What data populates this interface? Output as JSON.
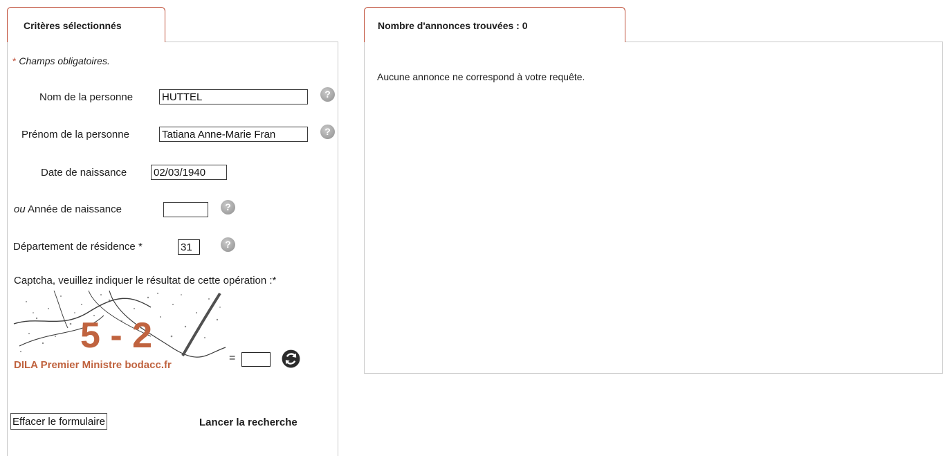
{
  "criteria_panel": {
    "title": "Critères sélectionnés",
    "required_star": "*",
    "required_note": "Champs obligatoires.",
    "fields": {
      "last_name": {
        "label": "Nom de la personne",
        "value": "HUTTEL"
      },
      "first_name": {
        "label": "Prénom de la personne",
        "value": "Tatiana Anne-Marie Fran"
      },
      "birth_date": {
        "label": "Date de naissance",
        "value": "02/03/1940"
      },
      "birth_year": {
        "label_prefix": "ou",
        "label": "Année de naissance",
        "value": ""
      },
      "department": {
        "label": "Département de résidence *",
        "value": "31"
      }
    },
    "captcha": {
      "label": "Captcha, veuillez indiquer le résultat de cette opération :*",
      "image_text": "5 - 2",
      "image_credit": "DILA Premier Ministre bodacc.fr",
      "equals": "=",
      "answer": ""
    },
    "buttons": {
      "clear": "Effacer le formulaire",
      "search": "Lancer la recherche"
    }
  },
  "results_panel": {
    "title": "Nombre d'annonces trouvées : 0",
    "empty_message": "Aucune annonce ne correspond à votre requête."
  },
  "icons": {
    "help": "help-icon",
    "refresh": "refresh-icon"
  },
  "colors": {
    "tab_border": "#c0503a",
    "captcha_text": "#c0633f",
    "help_icon": "#9a9a9a"
  }
}
